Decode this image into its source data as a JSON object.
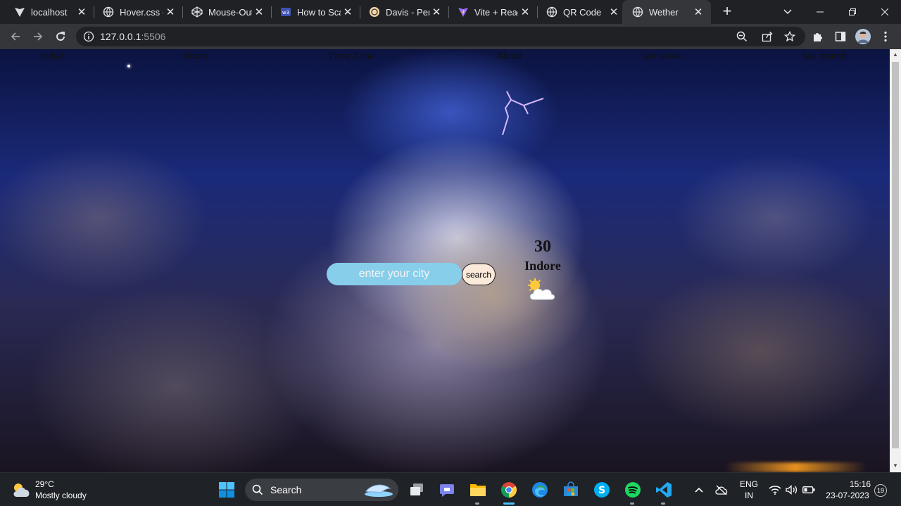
{
  "browser": {
    "tabs": [
      {
        "title": "localhost",
        "icon": "vite-icon",
        "active": false
      },
      {
        "title": "Hover.css -",
        "icon": "globe-icon",
        "active": false
      },
      {
        "title": "Mouse-Out",
        "icon": "codepen-icon",
        "active": false
      },
      {
        "title": "How to Sca",
        "icon": "w3-icon",
        "active": false
      },
      {
        "title": "Davis - Pers",
        "icon": "portfolio-icon",
        "active": false
      },
      {
        "title": "Vite + Reac",
        "icon": "vite-icon",
        "active": false
      },
      {
        "title": "QR Code",
        "icon": "globe-icon",
        "active": false
      },
      {
        "title": "Wether",
        "icon": "globe-icon",
        "active": true
      }
    ],
    "url_host": "127.0.0.1",
    "url_port": ":5506"
  },
  "page": {
    "nav": [
      "today",
      "Hours",
      "Time Zone",
      "About",
      "last week",
      "last month"
    ],
    "search": {
      "placeholder": "enter your city",
      "button_label": "search"
    },
    "weather": {
      "temperature": "30",
      "city": "Indore",
      "icon": "partly-cloudy-icon"
    }
  },
  "taskbar": {
    "weather_temp": "29°C",
    "weather_desc": "Mostly cloudy",
    "search_label": "Search",
    "language_line1": "ENG",
    "language_line2": "IN",
    "time": "15:16",
    "date": "23-07-2023",
    "notification_count": "19"
  },
  "colors": {
    "search_input_bg": "#87ceeb",
    "search_button_bg": "#fbe9d9",
    "chrome_dark": "#202124",
    "chrome_toolbar": "#35363a"
  }
}
